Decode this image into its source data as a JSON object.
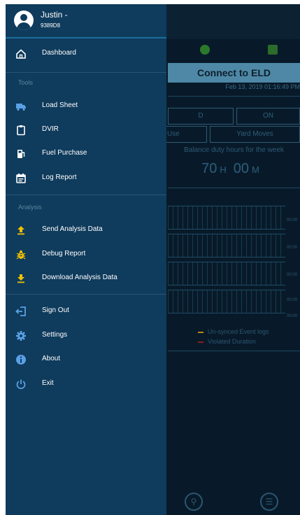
{
  "drawer": {
    "user": {
      "name": "Justin -",
      "id": "9389D8"
    },
    "dashboard": {
      "label": "Dashboard"
    },
    "sections": {
      "tools": "Tools",
      "analysis": "Analysis"
    },
    "tools_items": [
      {
        "label": "Load Sheet",
        "icon": "truck-icon"
      },
      {
        "label": "DVIR",
        "icon": "clipboard-icon"
      },
      {
        "label": "Fuel Purchase",
        "icon": "fuel-pump-icon"
      },
      {
        "label": "Log Report",
        "icon": "calendar-icon"
      }
    ],
    "analysis_items": [
      {
        "label": "Send Analysis Data",
        "icon": "upload-icon"
      },
      {
        "label": "Debug Report",
        "icon": "bug-icon"
      },
      {
        "label": "Download Analysis Data",
        "icon": "download-icon"
      }
    ],
    "misc_items": [
      {
        "label": "Sign Out",
        "icon": "sign-out-icon"
      },
      {
        "label": "Settings",
        "icon": "gear-icon"
      },
      {
        "label": "About",
        "icon": "info-icon"
      },
      {
        "label": "Exit",
        "icon": "power-icon"
      }
    ]
  },
  "background": {
    "connect_label": "Connect to ELD",
    "date": "Feb 13, 2019 01:16:49 PM",
    "status_buttons": [
      "D",
      "ON"
    ],
    "mode_buttons": [
      "Use",
      "Yard Moves"
    ],
    "balance_label": "Balance duty hours for the week",
    "hours_value": "70",
    "hours_unit": "H",
    "minutes_value": "00",
    "minutes_unit": "M",
    "graph_labels": [
      "00:00",
      "00:00",
      "00:00",
      "00:00",
      "00:00"
    ],
    "legend": [
      "Un-synced Event logs",
      "Violated Duration"
    ],
    "colors": {
      "drawer_bg": "#0f3b5c",
      "app_bg": "#081a29",
      "accent": "#1b6f9b",
      "legend_orange": "#b78a10",
      "legend_red": "#8a1c1c"
    }
  }
}
